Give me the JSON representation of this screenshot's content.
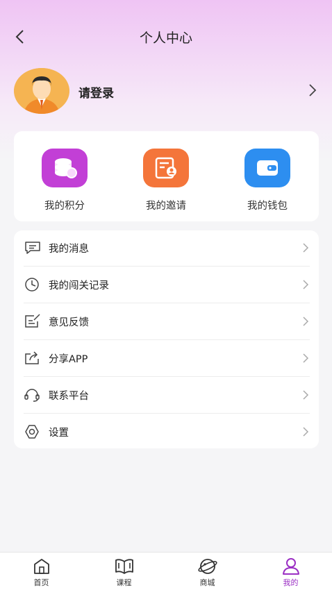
{
  "header": {
    "title": "个人中心"
  },
  "profile": {
    "login_label": "请登录"
  },
  "quick_actions": [
    {
      "label": "我的积分",
      "icon": "coins-icon",
      "color": "#c23fd6"
    },
    {
      "label": "我的邀请",
      "icon": "invite-icon",
      "color": "#f4753a"
    },
    {
      "label": "我的钱包",
      "icon": "wallet-icon",
      "color": "#2d8ef0"
    }
  ],
  "menu": [
    {
      "label": "我的消息",
      "icon": "message-icon"
    },
    {
      "label": "我的闯关记录",
      "icon": "clock-icon"
    },
    {
      "label": "意见反馈",
      "icon": "feedback-icon"
    },
    {
      "label": "分享APP",
      "icon": "share-icon"
    },
    {
      "label": "联系平台",
      "icon": "headset-icon"
    },
    {
      "label": "设置",
      "icon": "gear-icon"
    }
  ],
  "tabbar": [
    {
      "label": "首页",
      "icon": "home-icon",
      "active": false
    },
    {
      "label": "课程",
      "icon": "book-icon",
      "active": false
    },
    {
      "label": "商城",
      "icon": "planet-icon",
      "active": false
    },
    {
      "label": "我的",
      "icon": "user-icon",
      "active": true
    }
  ],
  "colors": {
    "accent": "#9b2fc4"
  }
}
